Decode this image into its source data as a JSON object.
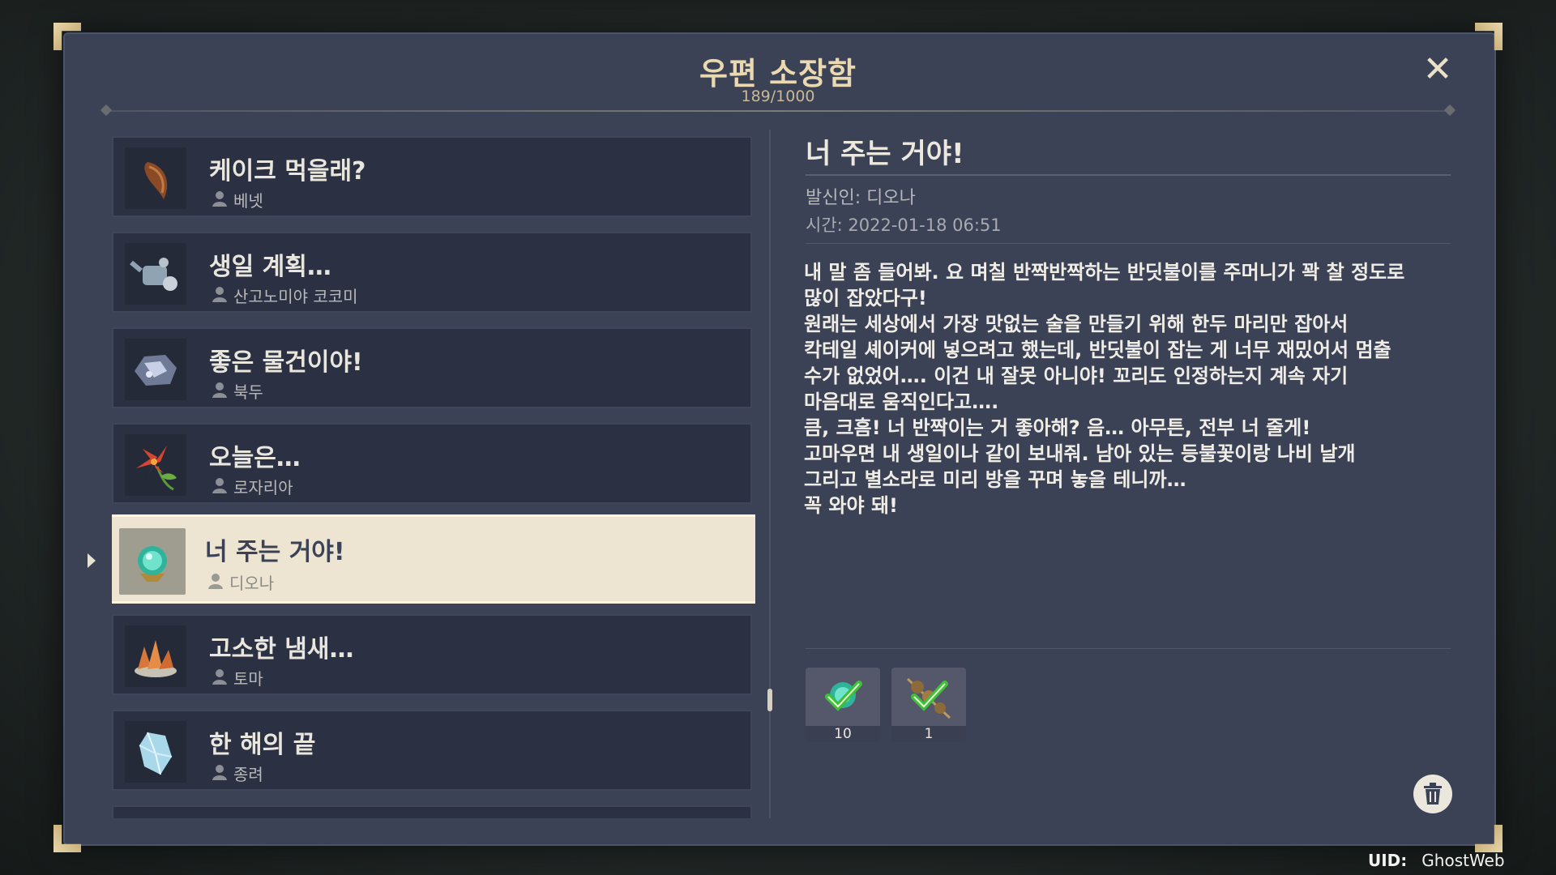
{
  "mailbox": {
    "title": "우편 소장함",
    "count": "189/1000",
    "close_icon": "close-icon"
  },
  "mail_list": [
    {
      "subject": "케이크 먹을래?",
      "sender": "베넷",
      "icon": "horn-icon"
    },
    {
      "subject": "생일 계획…",
      "sender": "산고노미야 코코미",
      "icon": "watering-can-icon"
    },
    {
      "subject": "좋은 물건이야!",
      "sender": "북두",
      "icon": "ore-icon"
    },
    {
      "subject": "오늘은…",
      "sender": "로자리아",
      "icon": "flower-icon"
    },
    {
      "subject": "너 주는 거야!",
      "sender": "디오나",
      "icon": "glowing-orb-icon",
      "selected": true
    },
    {
      "subject": "고소한 냄새…",
      "sender": "토마",
      "icon": "food-dish-icon"
    },
    {
      "subject": "한 해의 끝",
      "sender": "종려",
      "icon": "crystal-icon"
    }
  ],
  "detail": {
    "title": "너 주는 거야!",
    "sender": "발신인: 디오나",
    "time": "시간: 2022-01-18 06:51",
    "body": "내 말 좀 들어봐. 요 며칠 반짝반짝하는 반딧불이를 주머니가 꽉 찰 정도로\n많이 잡았다구!\n원래는 세상에서 가장 맛없는 술을 만들기 위해 한두 마리만 잡아서\n칵테일 셰이커에 넣으려고 했는데, 반딧불이 잡는 게 너무 재밌어서 멈출\n수가 없었어…. 이건 내 잘못 아니야! 꼬리도 인정하는지 계속 자기\n마음대로 움직인다고….\n큼, 크흠! 너 반짝이는 거 좋아해? 음… 아무튼, 전부 너 줄게!\n고마우면 내 생일이나 같이 보내줘. 남아 있는 등불꽃이랑 나비 날개\n그리고 별소라로 미리 방을 꾸며 놓을 테니까…\n꼭 와야 돼!",
    "attachments": [
      {
        "icon": "glowing-orb-icon",
        "qty": "10",
        "claimed": true
      },
      {
        "icon": "skewer-icon",
        "qty": "1",
        "claimed": true
      }
    ],
    "delete_icon": "trash-icon"
  },
  "uid": {
    "label": "UID:",
    "value": "GhostWeb"
  },
  "colors": {
    "panel": "#3b4256",
    "gold": "#e9d8b0",
    "selected": "#ede4d2",
    "check": "#4caf3a"
  }
}
